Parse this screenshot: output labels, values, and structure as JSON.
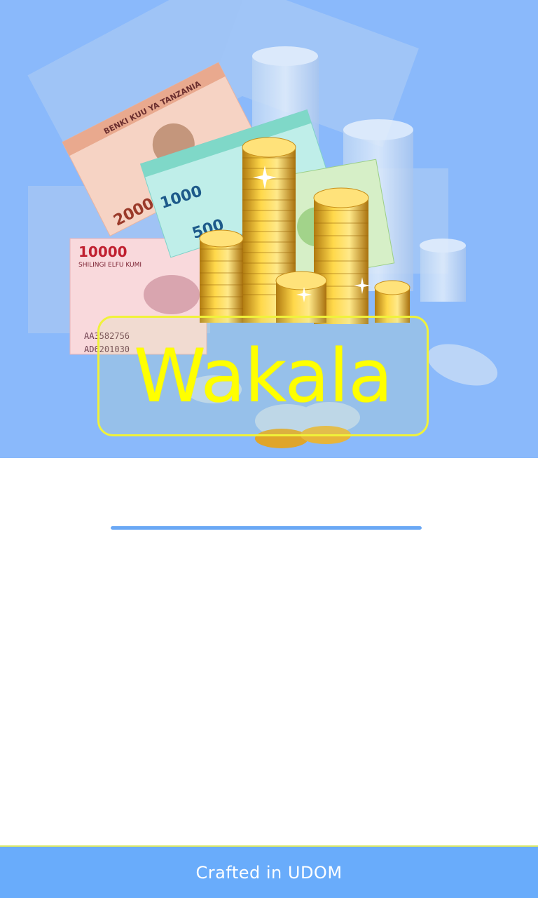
{
  "hero": {
    "logo_text": "Wakala",
    "background_color": "#8ab9fb",
    "accent_color": "#ffff00",
    "illustration": "tanzanian-shilling-banknotes-and-gold-coins",
    "banknote_text": {
      "issuer": "BENKI KUU YA TANZANIA",
      "denominations": [
        "10000",
        "2000",
        "1000",
        "500"
      ],
      "note_10000_caption": "SHILINGI ELFU KUMI",
      "serials": [
        "AA3582756",
        "AD6201030"
      ]
    }
  },
  "loading": {
    "progress": 1.0,
    "color": "#6aa8f5"
  },
  "footer": {
    "text": "Crafted  in  UDOM",
    "background_color": "#69acfb"
  }
}
